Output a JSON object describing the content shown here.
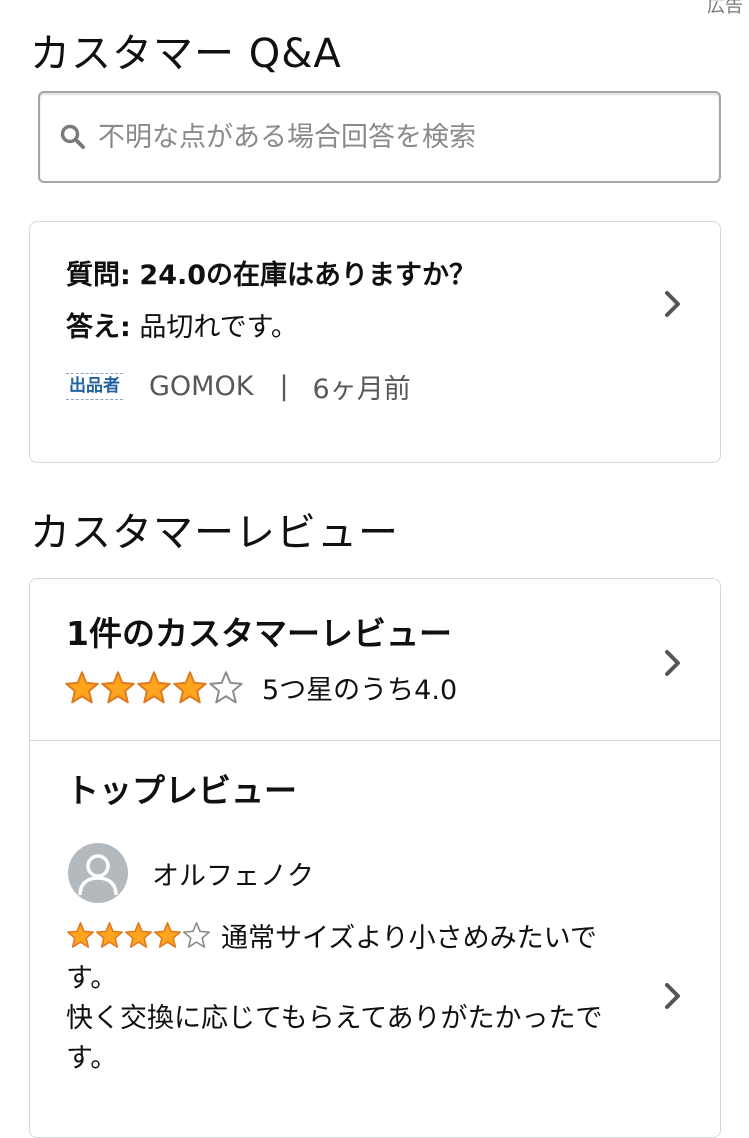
{
  "ad_label": "広告",
  "qa": {
    "title": "カスタマー Q&A",
    "search": {
      "placeholder": "不明な点がある場合回答を検索",
      "value": "",
      "icon": "search-icon"
    },
    "question": {
      "question_label": "質問:",
      "question_text": "24.0の在庫はありますか？",
      "answer_label": "答え:",
      "answer_text": "品切れです。",
      "badge": "出品者",
      "answerer": "GOMOK",
      "separator": "|",
      "time_ago": "6ヶ月前"
    }
  },
  "reviews": {
    "title": "カスタマーレビュー",
    "summary": {
      "count_label": "1件のカスタマーレビュー",
      "rating": 4.0,
      "rating_max": 5,
      "rating_text": "5つ星のうち4.0"
    },
    "top_reviews": {
      "title": "トップレビュー",
      "items": [
        {
          "reviewer": "オルフェノク",
          "rating": 4,
          "rating_max": 5,
          "text_line1": "通常サイズより小さめみたいです。",
          "text_line2": "快く交換に応じてもらえてありがたかったです。"
        }
      ]
    }
  },
  "colors": {
    "star_fill": "#ffa41c",
    "star_outline": "#de7921",
    "seller_badge": "#2162a1",
    "border": "#d5d9d9",
    "muted_text": "#565959"
  }
}
